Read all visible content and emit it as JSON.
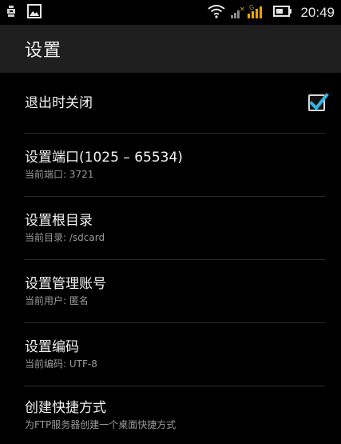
{
  "status_bar": {
    "time": "20:49",
    "icons": [
      "usb-debug-icon",
      "image-notification-icon",
      "wifi-icon",
      "signal-icon",
      "battery-icon"
    ],
    "network_type": "G"
  },
  "action_bar": {
    "title": "设置"
  },
  "preferences": [
    {
      "title": "退出时关闭",
      "summary": "",
      "checked": true
    },
    {
      "title": "设置端口(1025 – 65534)",
      "summary": "当前端口: 3721"
    },
    {
      "title": "设置根目录",
      "summary": "当前目录: /sdcard"
    },
    {
      "title": "设置管理账号",
      "summary": "当前用户: 匿名"
    },
    {
      "title": "设置编码",
      "summary": "当前编码: UTF-8"
    },
    {
      "title": "创建快捷方式",
      "summary": "为FTP服务器创建一个桌面快捷方式"
    }
  ],
  "colors": {
    "background": "#000000",
    "action_bar": "#1f1f1f",
    "accent": "#33b5e5",
    "divider": "#2c2c2c"
  }
}
